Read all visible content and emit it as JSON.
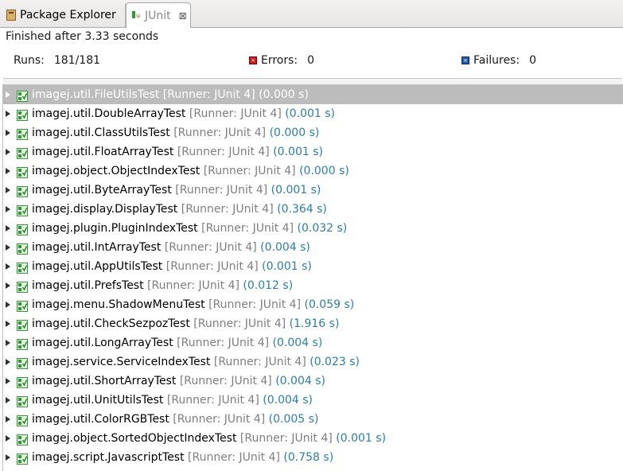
{
  "tabs": [
    {
      "label": "Package Explorer",
      "icon": "package-explorer-icon",
      "active": false
    },
    {
      "label": "JUnit",
      "icon": "junit-icon",
      "active": true,
      "close": "⊠"
    }
  ],
  "status": "Finished after 3.33 seconds",
  "counters": {
    "runs_label": "Runs:",
    "runs_value": "181/181",
    "errors_label": "Errors:",
    "errors_value": "0",
    "failures_label": "Failures:",
    "failures_value": "0"
  },
  "progress": {
    "fraction": 1.0,
    "color": "#f3f3f3"
  },
  "colors": {
    "time": "#2a7fb0",
    "runner": "#7f7f7f",
    "selected_row": "#bcbcbc",
    "suite_icon_green": "#2e9b2e"
  },
  "tests": [
    {
      "name": "imagej.util.FileUtilsTest",
      "runner": "[Runner: JUnit 4]",
      "time": "(0.000 s)",
      "selected": true
    },
    {
      "name": "imagej.util.DoubleArrayTest",
      "runner": "[Runner: JUnit 4]",
      "time": "(0.001 s)"
    },
    {
      "name": "imagej.util.ClassUtilsTest",
      "runner": "[Runner: JUnit 4]",
      "time": "(0.000 s)"
    },
    {
      "name": "imagej.util.FloatArrayTest",
      "runner": "[Runner: JUnit 4]",
      "time": "(0.001 s)"
    },
    {
      "name": "imagej.object.ObjectIndexTest",
      "runner": "[Runner: JUnit 4]",
      "time": "(0.000 s)"
    },
    {
      "name": "imagej.util.ByteArrayTest",
      "runner": "[Runner: JUnit 4]",
      "time": "(0.001 s)"
    },
    {
      "name": "imagej.display.DisplayTest",
      "runner": "[Runner: JUnit 4]",
      "time": "(0.364 s)"
    },
    {
      "name": "imagej.plugin.PluginIndexTest",
      "runner": "[Runner: JUnit 4]",
      "time": "(0.032 s)"
    },
    {
      "name": "imagej.util.IntArrayTest",
      "runner": "[Runner: JUnit 4]",
      "time": "(0.004 s)"
    },
    {
      "name": "imagej.util.AppUtilsTest",
      "runner": "[Runner: JUnit 4]",
      "time": "(0.001 s)"
    },
    {
      "name": "imagej.util.PrefsTest",
      "runner": "[Runner: JUnit 4]",
      "time": "(0.012 s)"
    },
    {
      "name": "imagej.menu.ShadowMenuTest",
      "runner": "[Runner: JUnit 4]",
      "time": "(0.059 s)"
    },
    {
      "name": "imagej.util.CheckSezpozTest",
      "runner": "[Runner: JUnit 4]",
      "time": "(1.916 s)"
    },
    {
      "name": "imagej.util.LongArrayTest",
      "runner": "[Runner: JUnit 4]",
      "time": "(0.004 s)"
    },
    {
      "name": "imagej.service.ServiceIndexTest",
      "runner": "[Runner: JUnit 4]",
      "time": "(0.023 s)"
    },
    {
      "name": "imagej.util.ShortArrayTest",
      "runner": "[Runner: JUnit 4]",
      "time": "(0.004 s)"
    },
    {
      "name": "imagej.util.UnitUtilsTest",
      "runner": "[Runner: JUnit 4]",
      "time": "(0.004 s)"
    },
    {
      "name": "imagej.util.ColorRGBTest",
      "runner": "[Runner: JUnit 4]",
      "time": "(0.005 s)"
    },
    {
      "name": "imagej.object.SortedObjectIndexTest",
      "runner": "[Runner: JUnit 4]",
      "time": "(0.001 s)"
    },
    {
      "name": "imagej.script.JavascriptTest",
      "runner": "[Runner: JUnit 4]",
      "time": "(0.758 s)"
    }
  ]
}
